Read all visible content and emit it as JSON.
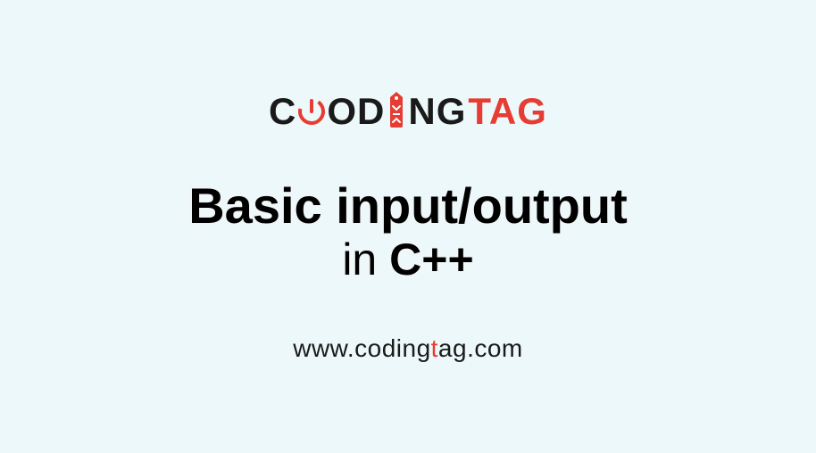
{
  "logo": {
    "part1_c": "C",
    "part1_od": "OD",
    "part1_ng": "NG",
    "part2": "TAG"
  },
  "title": {
    "line1": "Basic input/output",
    "line2_in": "in ",
    "line2_cpp": "C++"
  },
  "url": {
    "part1": "www.coding",
    "t": "t",
    "part2": "ag.com"
  }
}
